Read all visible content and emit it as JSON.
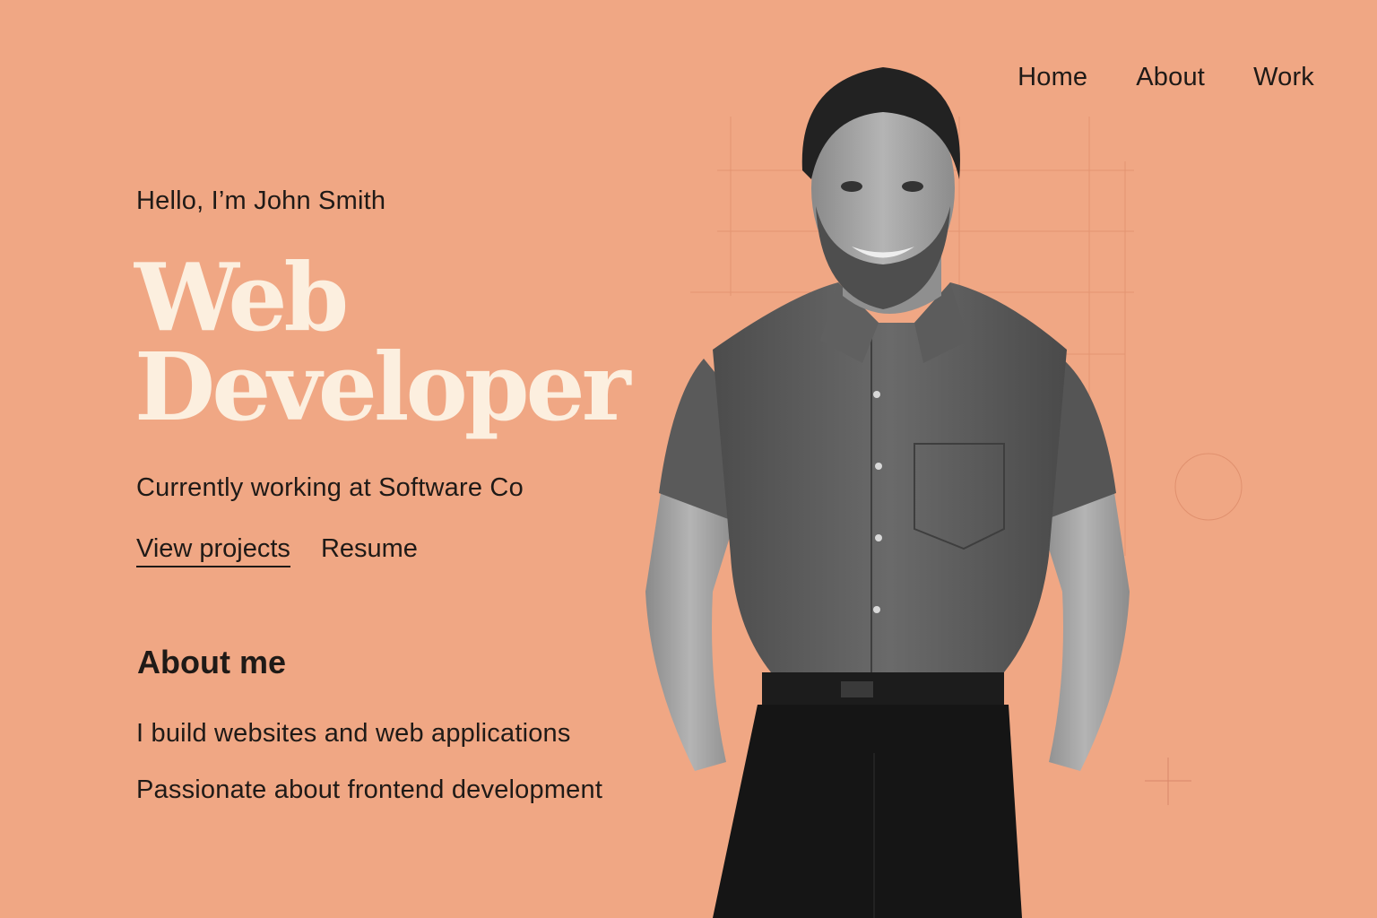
{
  "nav": {
    "items": [
      "Home",
      "About",
      "Work"
    ]
  },
  "hero": {
    "greeting": "Hello, I’m John Smith",
    "title_line1": "Web",
    "title_line2": "Developer",
    "subtitle": "Currently working at Software Co",
    "primary_link": "View projects",
    "secondary_link": "Resume"
  },
  "about": {
    "heading": "About me",
    "line1": "I build websites and web applications",
    "line2": "Passionate about frontend development"
  },
  "colors": {
    "background": "#f0a784",
    "title": "#fcefdf",
    "text": "#1f1a17"
  },
  "icons": [
    "portrait-photo",
    "decorative-circle",
    "plus-mark"
  ]
}
